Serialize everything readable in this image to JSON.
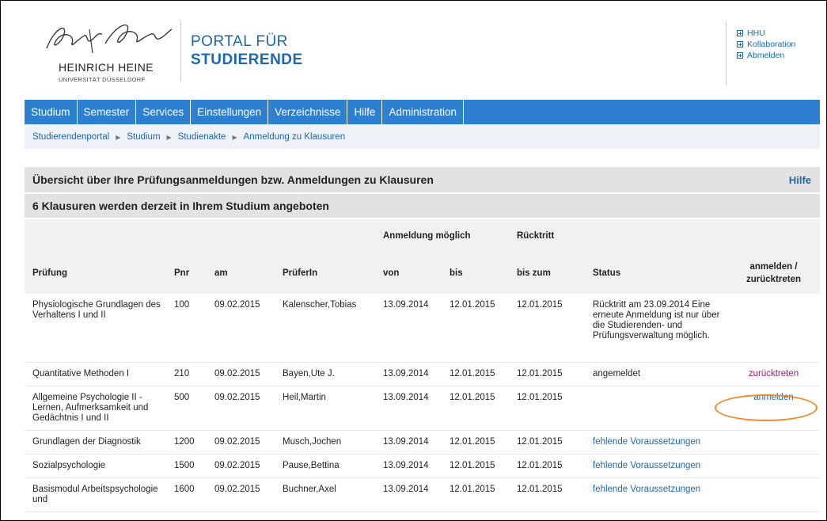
{
  "header": {
    "logo_name": "HEINRICH HEINE",
    "logo_sub": "UNIVERSITÄT DÜSSELDORF",
    "portal_line1": "PORTAL FÜR",
    "portal_line2": "STUDIERENDE",
    "top_links": [
      "HHU",
      "Kollaboration",
      "Abmelden"
    ]
  },
  "nav": {
    "items": [
      "Studium",
      "Semester",
      "Services",
      "Einstellungen",
      "Verzeichnisse",
      "Hilfe",
      "Administration"
    ]
  },
  "breadcrumb": [
    "Studierendenportal",
    "Studium",
    "Studienakte",
    "Anmeldung zu Klausuren"
  ],
  "overview": {
    "title": "Übersicht über Ihre Prüfungsanmeldungen bzw. Anmeldungen zu Klausuren",
    "help": "Hilfe",
    "subtitle": "6 Klausuren werden derzeit in Ihrem Studium angeboten"
  },
  "table": {
    "group_headers": {
      "anmeldung": "Anmeldung möglich",
      "ruecktritt": "Rücktritt"
    },
    "headers": {
      "pruefung": "Prüfung",
      "pnr": "Pnr",
      "am": "am",
      "pruefer": "PrüferIn",
      "von": "von",
      "bis": "bis",
      "bis_zum": "bis zum",
      "status": "Status",
      "action_1": "anmelden /",
      "action_2": "zurücktreten"
    },
    "rows": [
      {
        "pruefung": "Physiologische Grundlagen des Verhaltens I und II",
        "pnr": "100",
        "am": "09.02.2015",
        "pruefer": "Kalenscher,Tobias",
        "von": "13.09.2014",
        "bis": "12.01.2015",
        "bis_zum": "12.01.2015",
        "status": "Rücktritt am 23.09.2014 Eine erneute Anmeldung ist nur über die Studierenden- und Prüfungsverwaltung möglich.",
        "action": ""
      },
      {
        "pruefung": "Quantitative Methoden I",
        "pnr": "210",
        "am": "09.02.2015",
        "pruefer": "Bayen,Ute J.",
        "von": "13.09.2014",
        "bis": "12.01.2015",
        "bis_zum": "12.01.2015",
        "status": "angemeldet",
        "action": "zurücktreten"
      },
      {
        "pruefung": "Allgemeine Psychologie II - Lernen, Aufmerksamkeit und Gedächtnis I und II",
        "pnr": "500",
        "am": "09.02.2015",
        "pruefer": "Heil,Martin",
        "von": "13.09.2014",
        "bis": "12.01.2015",
        "bis_zum": "12.01.2015",
        "status": "",
        "action": "anmelden"
      },
      {
        "pruefung": "Grundlagen der Diagnostik",
        "pnr": "1200",
        "am": "09.02.2015",
        "pruefer": "Musch,Jochen",
        "von": "13.09.2014",
        "bis": "12.01.2015",
        "bis_zum": "12.01.2015",
        "status": "fehlende Voraussetzungen",
        "action": ""
      },
      {
        "pruefung": "Sozialpsychologie",
        "pnr": "1500",
        "am": "09.02.2015",
        "pruefer": "Pause,Bettina",
        "von": "13.09.2014",
        "bis": "12.01.2015",
        "bis_zum": "12.01.2015",
        "status": "fehlende Voraussetzungen",
        "action": ""
      },
      {
        "pruefung": "Basismodul Arbeitspsychologie und",
        "pnr": "1600",
        "am": "09.02.2015",
        "pruefer": "Buchner,Axel",
        "von": "13.09.2014",
        "bis": "12.01.2015",
        "bis_zum": "12.01.2015",
        "status": "fehlende Voraussetzungen",
        "action": ""
      }
    ]
  },
  "colors": {
    "brand_blue": "#1b67b3",
    "nav_blue": "#2d7fcf",
    "highlight_orange": "#ef8b2c",
    "withdraw_purple": "#b0137a"
  }
}
